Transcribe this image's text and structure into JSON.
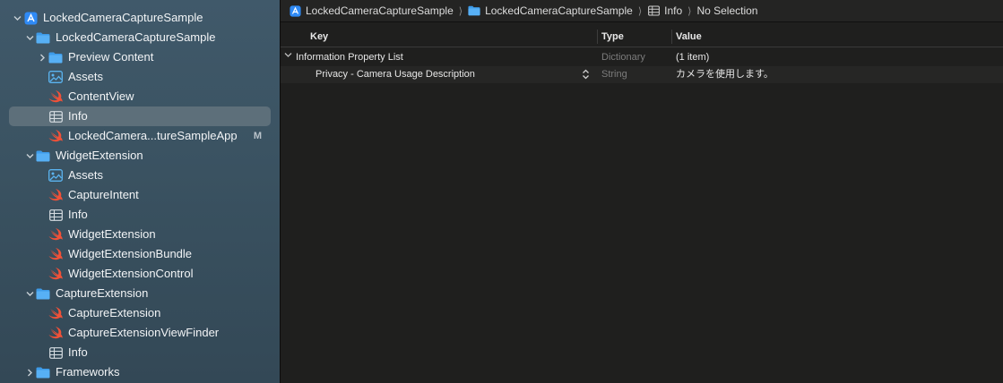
{
  "sidebar": {
    "items": [
      {
        "label": "LockedCameraCaptureSample",
        "icon": "xcode-project-icon",
        "chevron": "chevron-down-icon"
      },
      {
        "label": "LockedCameraCaptureSample",
        "icon": "folder-icon",
        "chevron": "chevron-down-icon"
      },
      {
        "label": "Preview Content",
        "icon": "folder-icon",
        "chevron": "chevron-right-icon"
      },
      {
        "label": "Assets",
        "icon": "asset-catalog-icon"
      },
      {
        "label": "ContentView",
        "icon": "swift-file-icon"
      },
      {
        "label": "Info",
        "icon": "plist-icon",
        "selected": true
      },
      {
        "label": "LockedCamera...tureSampleApp",
        "icon": "swift-file-icon",
        "badge": "M"
      },
      {
        "label": "WidgetExtension",
        "icon": "folder-icon",
        "chevron": "chevron-down-icon"
      },
      {
        "label": "Assets",
        "icon": "asset-catalog-icon"
      },
      {
        "label": "CaptureIntent",
        "icon": "swift-file-icon"
      },
      {
        "label": "Info",
        "icon": "plist-icon"
      },
      {
        "label": "WidgetExtension",
        "icon": "swift-file-icon"
      },
      {
        "label": "WidgetExtensionBundle",
        "icon": "swift-file-icon"
      },
      {
        "label": "WidgetExtensionControl",
        "icon": "swift-file-icon"
      },
      {
        "label": "CaptureExtension",
        "icon": "folder-icon",
        "chevron": "chevron-down-icon"
      },
      {
        "label": "CaptureExtension",
        "icon": "swift-file-icon"
      },
      {
        "label": "CaptureExtensionViewFinder",
        "icon": "swift-file-icon"
      },
      {
        "label": "Info",
        "icon": "plist-icon"
      },
      {
        "label": "Frameworks",
        "icon": "folder-icon",
        "chevron": "chevron-right-icon"
      }
    ]
  },
  "jumpbar": {
    "crumb1": "LockedCameraCaptureSample",
    "crumb2": "LockedCameraCaptureSample",
    "crumb3": "Info",
    "crumb4": "No Selection",
    "separator": "⟩"
  },
  "plist": {
    "headers": {
      "key": "Key",
      "type": "Type",
      "value": "Value"
    },
    "rows": [
      {
        "key": "Information Property List",
        "type": "Dictionary",
        "value": "(1 item)"
      },
      {
        "key": "Privacy - Camera Usage Description",
        "type": "String",
        "value": "カメラを使用します。"
      }
    ]
  },
  "colors": {
    "swift": "#f05138",
    "folder": "#3d9be9",
    "accent": "#2f8af5"
  }
}
